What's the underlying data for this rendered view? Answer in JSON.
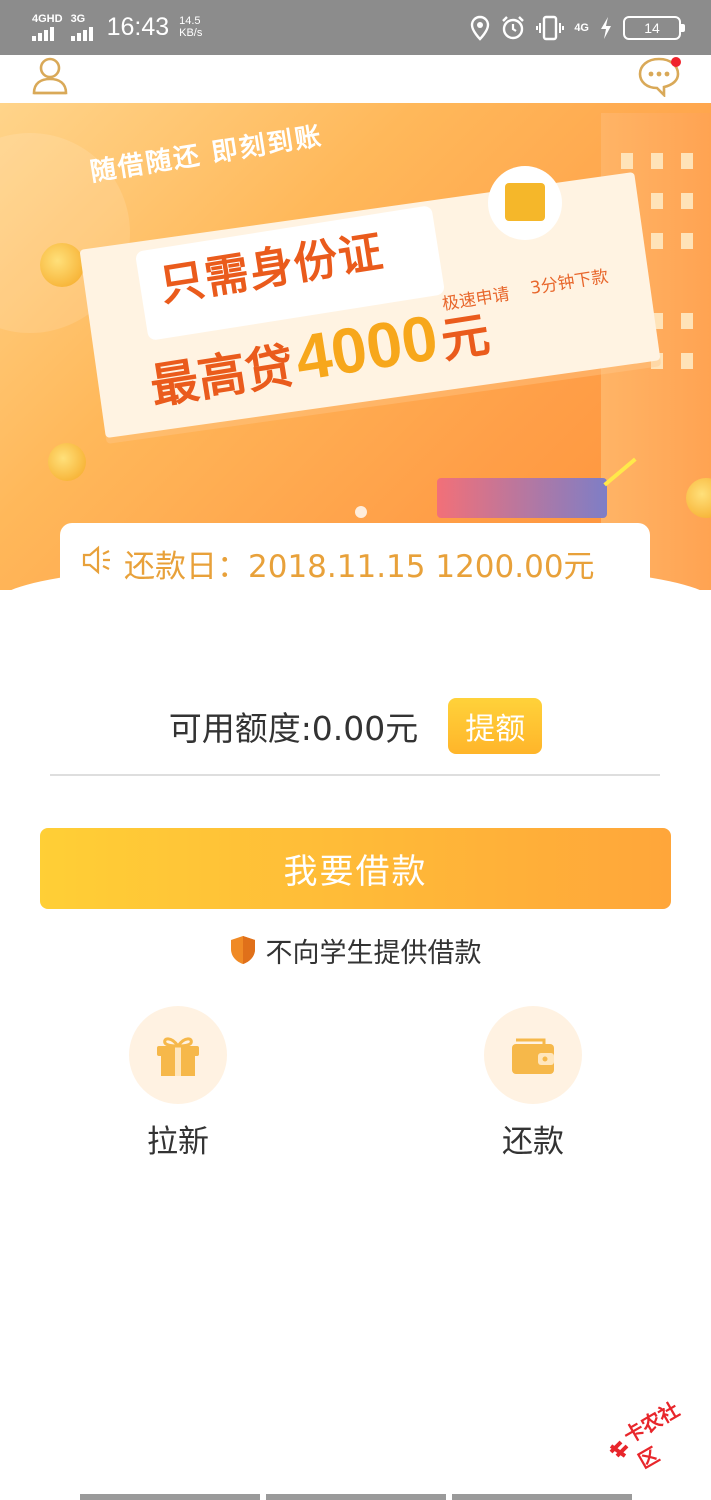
{
  "status_bar": {
    "net1": "4GHD",
    "net2": "3G",
    "time": "16:43",
    "speed_value": "14.5",
    "speed_unit": "KB/s",
    "net3": "4G",
    "battery": "14"
  },
  "header": {
    "user_icon": "user-icon",
    "message_icon": "message-icon"
  },
  "banner": {
    "slogan": "随借随还  即刻到账",
    "title": "只需身份证",
    "sub1": "极速申请",
    "sub2": "3分钟下款",
    "big_pre": "最高贷",
    "big_num": "4000",
    "big_unit": "元"
  },
  "notice": {
    "text": "还款日：2018.11.15  1200.00元"
  },
  "quota": {
    "text": "可用额度:0.00元",
    "raise_label": "提额"
  },
  "borrow_label": "我要借款",
  "student_notice": "不向学生提供借款",
  "features": [
    {
      "label": "拉新",
      "icon": "gift-icon"
    },
    {
      "label": "还款",
      "icon": "wallet-icon"
    }
  ],
  "watermark": "卡农社区",
  "colors": {
    "accent": "#ffb52a",
    "orange_text": "#e8a13a",
    "status_bar": "#8c8c8c"
  }
}
